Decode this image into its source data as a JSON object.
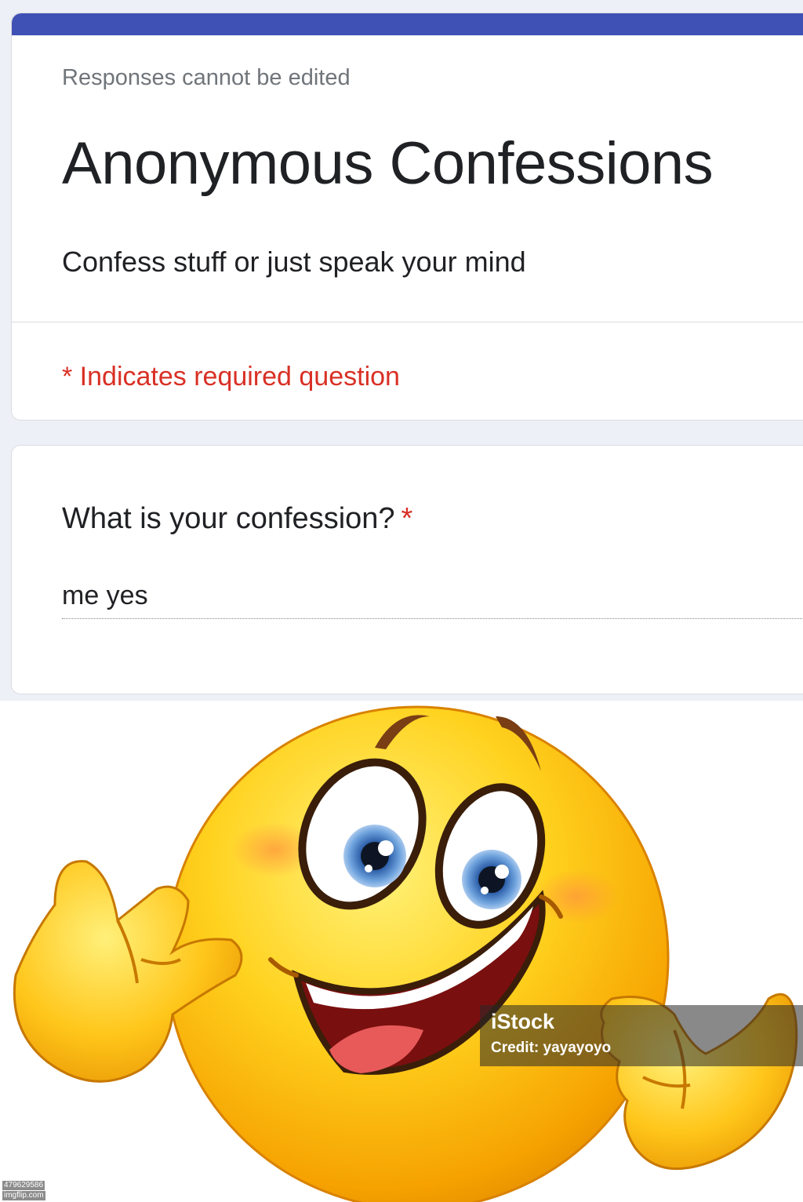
{
  "form": {
    "responses_note": "Responses cannot be edited",
    "title": "Anonymous Confessions",
    "description": "Confess stuff or just speak your mind",
    "required_note": "* Indicates required question",
    "question": {
      "label": "What is your confession?",
      "required_marker": "*",
      "answer": "me yes"
    }
  },
  "meme": {
    "watermark_brand": "iStock",
    "watermark_credit": "Credit: yayayoyo",
    "image_id": "479629586",
    "site": "imgflip.com"
  },
  "colors": {
    "accent": "#3f51b5",
    "required": "#d93025",
    "background": "#eef0f7"
  }
}
